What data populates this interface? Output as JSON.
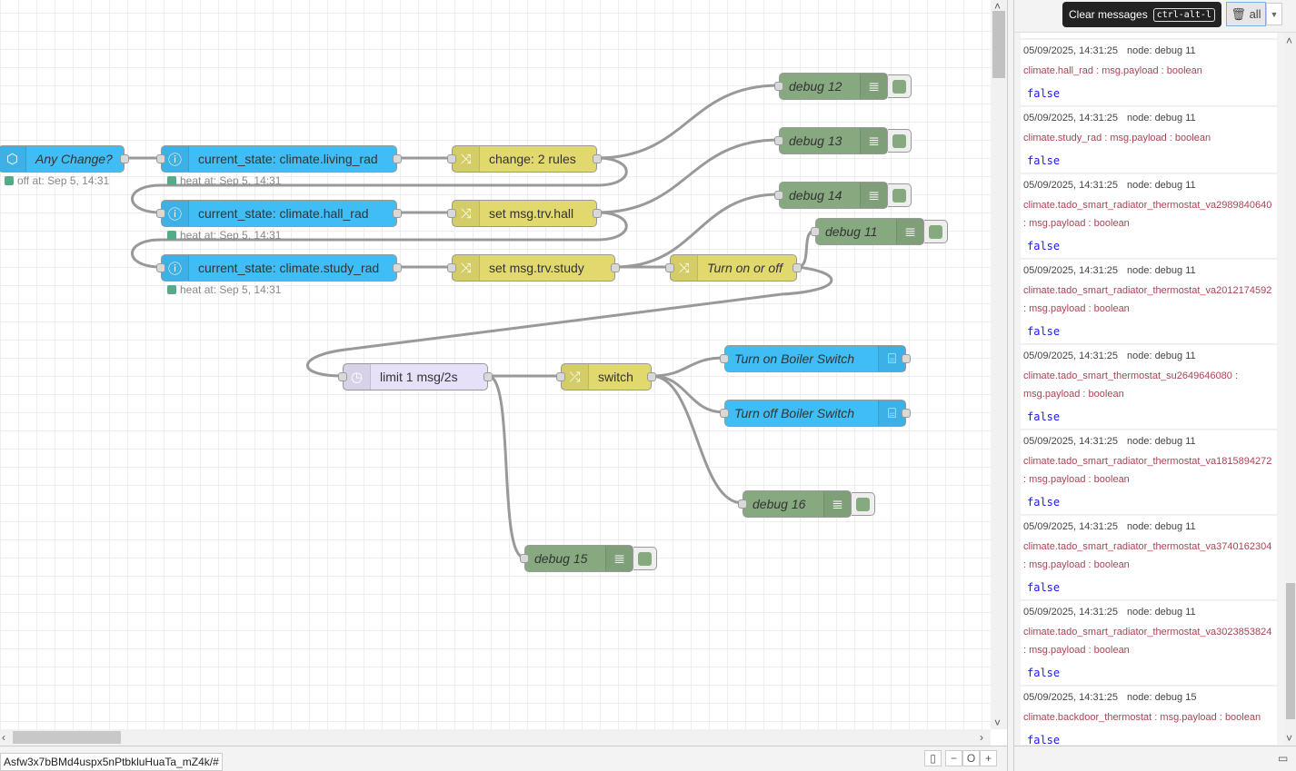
{
  "nodes": {
    "any_change": {
      "label": "Any Change?",
      "status": "off at: Sep 5, 14:31"
    },
    "living": {
      "label": "current_state: climate.living_rad",
      "status": "heat at: Sep 5, 14:31"
    },
    "hall": {
      "label": "current_state: climate.hall_rad",
      "status": "heat at: Sep 5, 14:31"
    },
    "study": {
      "label": "current_state: climate.study_rad",
      "status": "heat at: Sep 5, 14:31"
    },
    "change_rules": {
      "label": "change: 2 rules"
    },
    "set_hall": {
      "label": "set msg.trv.hall"
    },
    "set_study": {
      "label": "set msg.trv.study"
    },
    "turn_on_off": {
      "label": "Turn on or off"
    },
    "debug12": {
      "label": "debug 12"
    },
    "debug13": {
      "label": "debug 13"
    },
    "debug14": {
      "label": "debug 14"
    },
    "debug11": {
      "label": "debug 11"
    },
    "limit": {
      "label": "limit 1 msg/2s"
    },
    "switch": {
      "label": "switch"
    },
    "boiler_on": {
      "label": "Turn on Boiler Switch"
    },
    "boiler_off": {
      "label": "Turn off Boiler Switch"
    },
    "debug16": {
      "label": "debug 16"
    },
    "debug15": {
      "label": "debug 15"
    }
  },
  "footer": {
    "url": "Asfw3x7bBMd4uspx5nPtbkluHuaTa_mZ4k/#",
    "zoom_out": "−",
    "zoom_reset": "O",
    "zoom_in": "+"
  },
  "sidebar": {
    "tooltip": "Clear messages",
    "shortcut": "ctrl-alt-l",
    "clear_label": "all",
    "top_value": "false",
    "messages": [
      {
        "time": "05/09/2025, 14:31:25",
        "node": "node: debug 11",
        "topic": "climate.hall_rad : msg.payload : boolean",
        "value": "false"
      },
      {
        "time": "05/09/2025, 14:31:25",
        "node": "node: debug 11",
        "topic": "climate.study_rad : msg.payload : boolean",
        "value": "false"
      },
      {
        "time": "05/09/2025, 14:31:25",
        "node": "node: debug 11",
        "topic": "climate.tado_smart_radiator_thermostat_va2989840640 : msg.payload : boolean",
        "value": "false"
      },
      {
        "time": "05/09/2025, 14:31:25",
        "node": "node: debug 11",
        "topic": "climate.tado_smart_radiator_thermostat_va2012174592 : msg.payload : boolean",
        "value": "false"
      },
      {
        "time": "05/09/2025, 14:31:25",
        "node": "node: debug 11",
        "topic": "climate.tado_smart_thermostat_su2649646080 : msg.payload : boolean",
        "value": "false"
      },
      {
        "time": "05/09/2025, 14:31:25",
        "node": "node: debug 11",
        "topic": "climate.tado_smart_radiator_thermostat_va1815894272 : msg.payload : boolean",
        "value": "false"
      },
      {
        "time": "05/09/2025, 14:31:25",
        "node": "node: debug 11",
        "topic": "climate.tado_smart_radiator_thermostat_va3740162304 : msg.payload : boolean",
        "value": "false"
      },
      {
        "time": "05/09/2025, 14:31:25",
        "node": "node: debug 11",
        "topic": "climate.tado_smart_radiator_thermostat_va3023853824 : msg.payload : boolean",
        "value": "false"
      },
      {
        "time": "05/09/2025, 14:31:25",
        "node": "node: debug 15",
        "topic": "climate.backdoor_thermostat : msg.payload : boolean",
        "value": "false"
      }
    ]
  },
  "colors": {
    "ha_blue": "#41bdf5",
    "change_yellow": "#e2d96e",
    "debug_green": "#87a980",
    "delay_purple": "#e6e0f8",
    "status_green": "#55aa88",
    "topic_red": "#aa4455",
    "value_blue": "#1a1ae6"
  }
}
